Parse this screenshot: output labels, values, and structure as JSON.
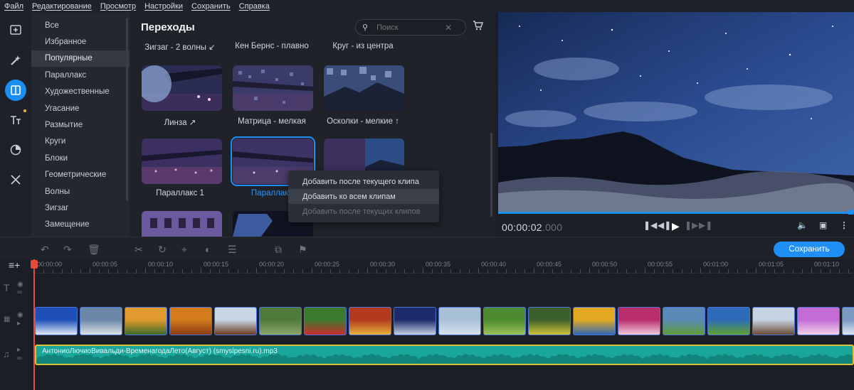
{
  "menu": [
    "Файл",
    "Редактирование",
    "Просмотр",
    "Настройки",
    "Сохранить",
    "Справка"
  ],
  "tools": [
    {
      "icon": "import-icon"
    },
    {
      "icon": "magic-wand-icon"
    },
    {
      "icon": "transitions-icon",
      "active": true
    },
    {
      "icon": "titles-icon",
      "badge": true
    },
    {
      "icon": "filters-icon"
    },
    {
      "icon": "more-tools-icon"
    }
  ],
  "categories": [
    "Все",
    "Избранное",
    "Популярные",
    "Параллакс",
    "Художественные",
    "Угасание",
    "Размытие",
    "Круги",
    "Блоки",
    "Геометрические",
    "Волны",
    "Зигзаг",
    "Замещение"
  ],
  "selected_category": "Популярные",
  "panel": {
    "title": "Переходы",
    "search_placeholder": "Поиск",
    "row0_labels": [
      "Зигзаг - 2 волны ↙",
      "Кен Бернс - плавно",
      "Круг - из центра"
    ],
    "row1_labels": [
      "Линза ↗",
      "Матрица - мелкая",
      "Осколки - мелкие ↑"
    ],
    "row2_labels": [
      "Параллакс 1",
      "Параллакс"
    ]
  },
  "context_menu": {
    "items": [
      "Добавить после текущего клипа",
      "Добавить ко всем клипам",
      "Добавить после текущих клипов"
    ]
  },
  "player": {
    "time": "00:00:02",
    "time_ms": ".000",
    "progress_percent": 100
  },
  "toolbar": {
    "save_label": "Сохранить"
  },
  "timeline": {
    "ticks": [
      "00:00:00",
      "00:00:05",
      "00:00:10",
      "00:00:15",
      "00:00:20",
      "00:00:25",
      "00:00:30",
      "00:00:35",
      "00:00:40",
      "00:00:45",
      "00:00:50",
      "00:00:55",
      "00:01:00",
      "00:01:05",
      "00:01:10"
    ],
    "audio_name": "АнтониоЛючиоВивальди-ВременагодаЛето(Август) (smyslpesni.ru).mp3",
    "clip_colors": [
      [
        "#1e4fb8",
        "#dfe8f6"
      ],
      [
        "#6c88a8",
        "#d9e0e6"
      ],
      [
        "#e19a2e",
        "#3f6a2b"
      ],
      [
        "#d47b1e",
        "#8a3b12"
      ],
      [
        "#c9d6e6",
        "#6b3b20"
      ],
      [
        "#4f7b3a",
        "#8da66a"
      ],
      [
        "#3c7a2e",
        "#c92e2e"
      ],
      [
        "#b33a1e",
        "#e8b23a"
      ],
      [
        "#1d2a6b",
        "#c5cfe2"
      ],
      [
        "#a7c0d8",
        "#d7e2ec"
      ],
      [
        "#4e8a2f",
        "#9cc25a"
      ],
      [
        "#3a5f2a",
        "#d2c33a"
      ],
      [
        "#e2a820",
        "#3268b6"
      ],
      [
        "#b82e6a",
        "#f0c9dc"
      ],
      [
        "#5a8ab8",
        "#5f9b35"
      ],
      [
        "#2d6bb8",
        "#5fa232"
      ],
      [
        "#c5d3e2",
        "#6b4a34"
      ],
      [
        "#c46bd4",
        "#f2d2ea"
      ],
      [
        "#7a9ac4",
        "#dce6f2"
      ]
    ]
  }
}
